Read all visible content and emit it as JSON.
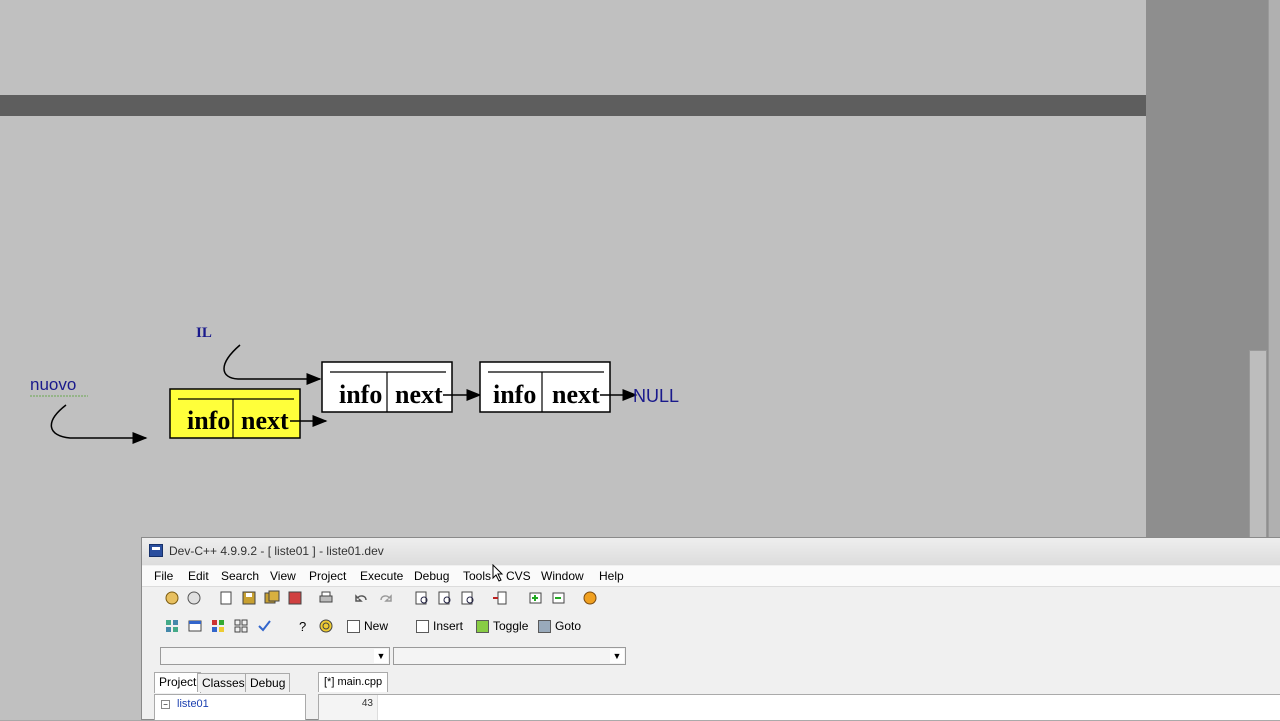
{
  "diagram": {
    "label_il": "IL",
    "label_nuovo": "nuovo",
    "node_new": {
      "info": "info",
      "next": "next"
    },
    "node_1": {
      "info": "info",
      "next": "next"
    },
    "node_2": {
      "info": "info",
      "next": "next"
    },
    "null_label": "NULL",
    "colors": {
      "new_node_fill": "#ffff3a",
      "label_color": "#1a1a8c"
    }
  },
  "devcpp": {
    "title": "Dev-C++ 4.9.9.2  -  [ liste01 ] - liste01.dev",
    "menu": [
      "File",
      "Edit",
      "Search",
      "View",
      "Project",
      "Execute",
      "Debug",
      "Tools",
      "CVS",
      "Window",
      "Help"
    ],
    "toolbar2_buttons": {
      "new": "New",
      "insert": "Insert",
      "toggle": "Toggle",
      "goto": "Goto"
    },
    "tabs_left": [
      "Project",
      "Classes",
      "Debug"
    ],
    "file_tab": "[*] main.cpp",
    "tree_root": "liste01",
    "line_number": "43"
  }
}
